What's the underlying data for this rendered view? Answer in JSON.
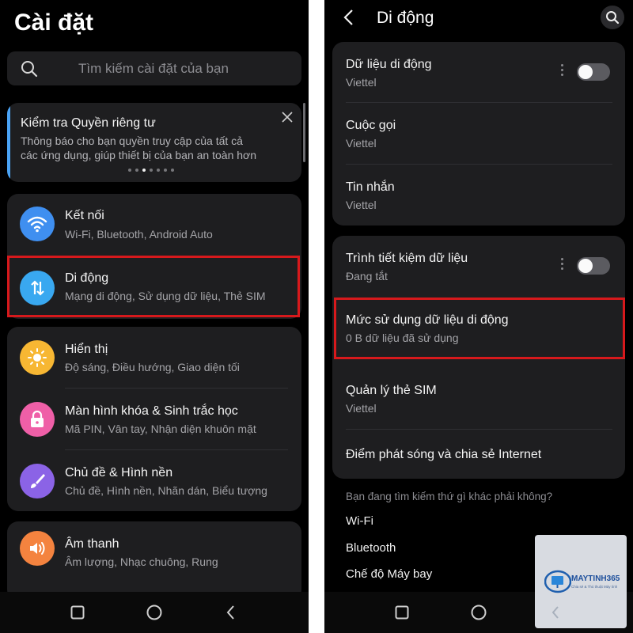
{
  "left": {
    "page_title": "Cài đặt",
    "search": {
      "placeholder": "Tìm kiếm cài đặt của bạn"
    },
    "privacy_card": {
      "title": "Kiểm tra Quyền riêng tư",
      "line1": "Thông báo cho bạn quyền truy cập của tất cả",
      "line2": "các ứng dụng, giúp thiết bị của bạn an toàn hơn"
    },
    "items": [
      {
        "title": "Kết nối",
        "subtitle": "Wi-Fi, Bluetooth, Android Auto",
        "icon": "wifi-icon",
        "color": "#3f8ff0"
      },
      {
        "title": "Di động",
        "subtitle": "Mạng di động, Sử dụng dữ liệu, Thẻ SIM",
        "icon": "data-transfer-icon",
        "color": "#39a8f0"
      },
      {
        "title": "Hiển thị",
        "subtitle": "Độ sáng, Điều hướng, Giao diện tối",
        "icon": "sun-icon",
        "color": "#f7b733"
      },
      {
        "title": "Màn hình khóa & Sinh trắc học",
        "subtitle": "Mã PIN, Vân tay, Nhận diện khuôn mặt",
        "icon": "lock-icon",
        "color": "#ef5fa7"
      },
      {
        "title": "Chủ đề & Hình nền",
        "subtitle": "Chủ đề, Hình nền, Nhãn dán, Biểu tượng",
        "icon": "brush-icon",
        "color": "#8b63e6"
      },
      {
        "title": "Âm thanh",
        "subtitle": "Âm lượng, Nhạc chuông, Rung",
        "icon": "speaker-icon",
        "color": "#f4833f"
      }
    ]
  },
  "right": {
    "page_title": "Di động",
    "group1": [
      {
        "title": "Dữ liệu di động",
        "subtitle": "Viettel",
        "toggle": false
      },
      {
        "title": "Cuộc gọi",
        "subtitle": "Viettel"
      },
      {
        "title": "Tin nhắn",
        "subtitle": "Viettel"
      }
    ],
    "group2": [
      {
        "title": "Trình tiết kiệm dữ liệu",
        "subtitle": "Đang tắt",
        "toggle": false
      },
      {
        "title": "Mức sử dụng dữ liệu di động",
        "subtitle": "0 B dữ liệu đã sử dụng"
      },
      {
        "title": "Quản lý thẻ SIM",
        "subtitle": "Viettel"
      },
      {
        "title": "Điểm phát sóng và chia sẻ Internet"
      }
    ],
    "suggestions": {
      "heading": "Bạn đang tìm kiếm thứ gì khác phải không?",
      "links": [
        "Wi-Fi",
        "Bluetooth",
        "Chế độ Máy bay"
      ]
    }
  },
  "watermark": {
    "brand": "MAYTINH365",
    "tagline": "Chia sẻ & Thủ thuật Máy tính"
  },
  "colors": {
    "highlight": "#d7191c",
    "card": "#1e1e20",
    "background": "#000000"
  }
}
